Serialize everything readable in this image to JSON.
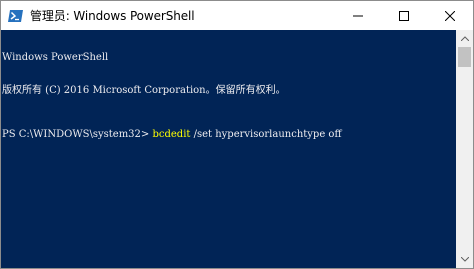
{
  "window": {
    "title": "管理员: Windows PowerShell",
    "icon": "powershell-icon"
  },
  "caption": {
    "minimize_icon": "minimize-icon",
    "maximize_icon": "maximize-icon",
    "close_icon": "close-icon"
  },
  "console": {
    "background": "#012456",
    "header_line1": "Windows PowerShell",
    "header_line2": "版权所有 (C) 2016 Microsoft Corporation。保留所有权利。",
    "prompt": "PS C:\\WINDOWS\\system32> ",
    "command": "bcdedit",
    "arguments": " /set hypervisorlaunchtype off",
    "command_color": "#ffff00"
  }
}
